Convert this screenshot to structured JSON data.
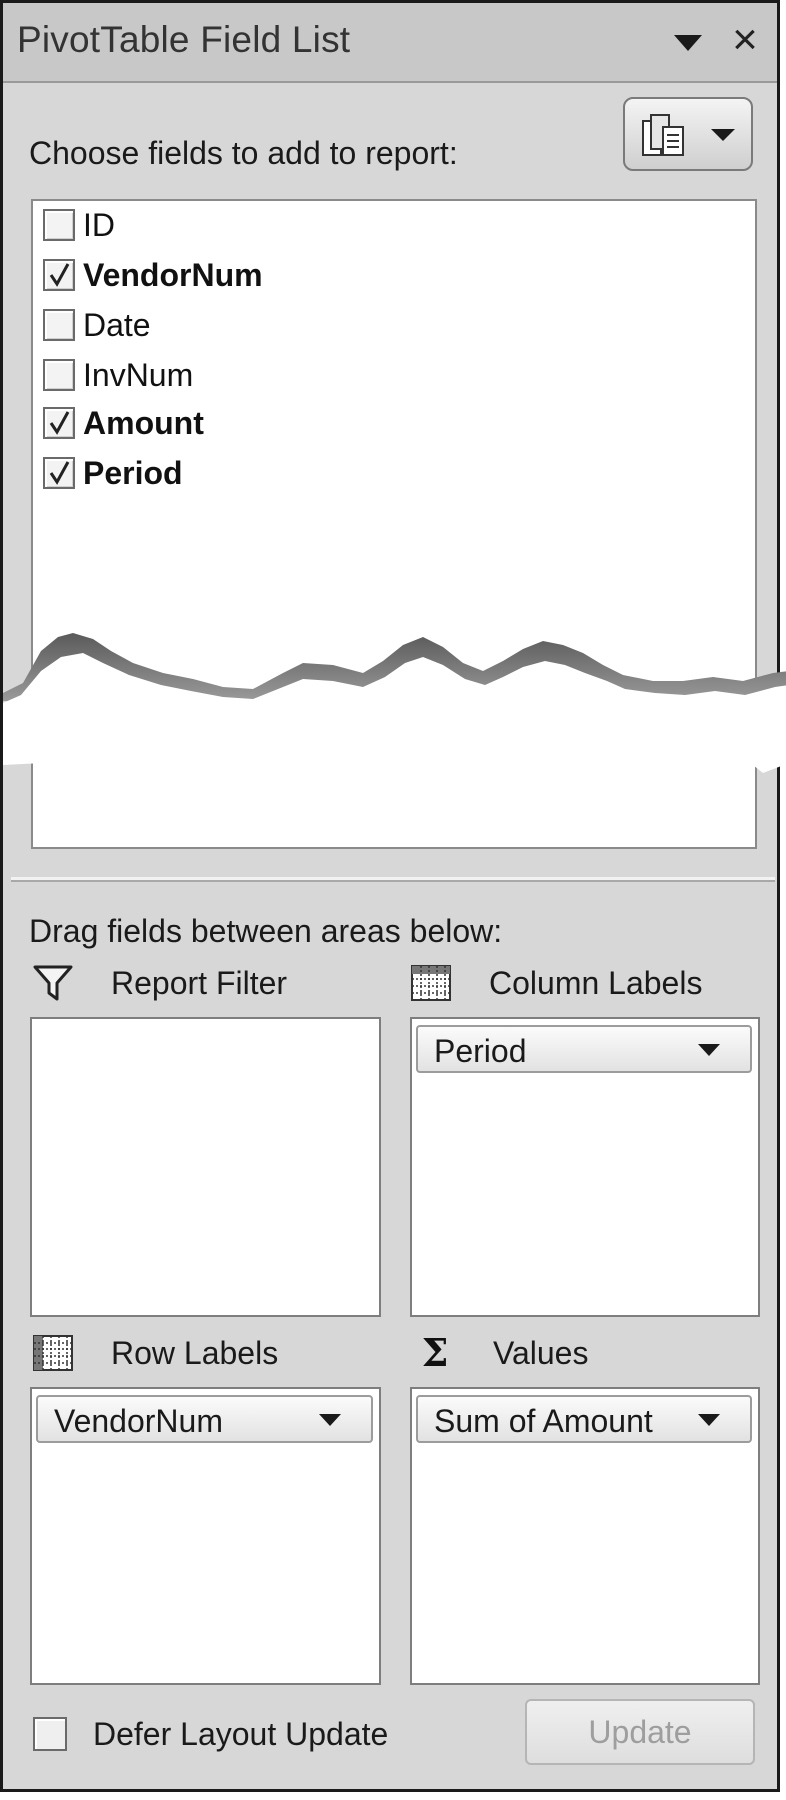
{
  "window": {
    "title": "PivotTable Field List",
    "dropdown_icon": "triangle-down-icon",
    "close_icon": "close-icon"
  },
  "field_section": {
    "label": "Choose fields to add to report:",
    "layout_button_icon": "field-list-layout-icon",
    "fields": [
      {
        "label": "ID",
        "checked": false
      },
      {
        "label": "VendorNum",
        "checked": true
      },
      {
        "label": "Date",
        "checked": false
      },
      {
        "label": "InvNum",
        "checked": false
      },
      {
        "label": "Amount",
        "checked": true
      },
      {
        "label": "Period",
        "checked": true
      }
    ]
  },
  "areas_section": {
    "label": "Drag fields between areas below:",
    "report_filter": {
      "label": "Report Filter",
      "icon": "filter-icon",
      "items": []
    },
    "column_labels": {
      "label": "Column Labels",
      "icon": "grid-icon",
      "items": [
        "Period"
      ]
    },
    "row_labels": {
      "label": "Row Labels",
      "icon": "grid-icon",
      "items": [
        "VendorNum"
      ]
    },
    "values": {
      "label": "Values",
      "icon": "sigma-icon",
      "items": [
        "Sum of Amount"
      ]
    }
  },
  "footer": {
    "defer_label": "Defer Layout Update",
    "defer_checked": false,
    "update_label": "Update",
    "update_enabled": false
  }
}
